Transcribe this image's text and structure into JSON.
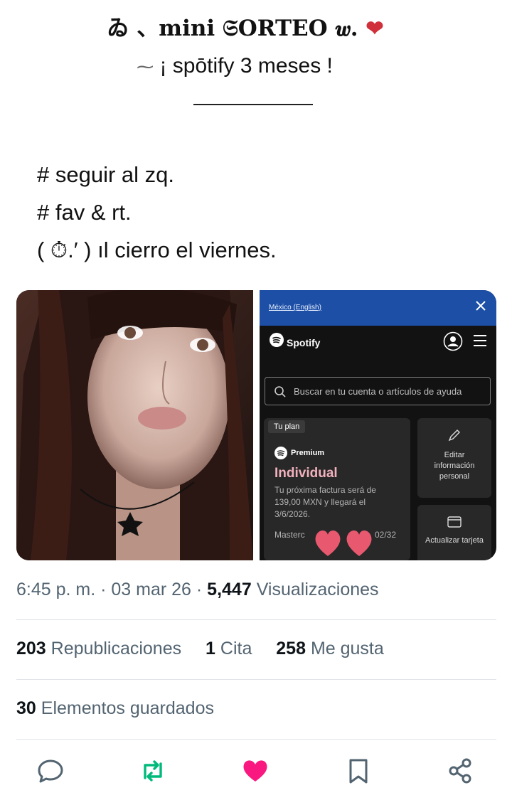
{
  "tweet": {
    "title": "ゐ 、mini 𝔖ORTEO  𝒘.",
    "title_emoji": "❤",
    "subtitle_deco": "⁓",
    "subtitle": "¡ spōtify 3 meses !",
    "lines": [
      "# seguir al zq.",
      "# fav & rt.",
      "( ⏱.′ ) ıl  cierro el viernes."
    ]
  },
  "media": {
    "screenshot": {
      "region_link": "México (English)",
      "brand": "Spotify",
      "search_placeholder": "Buscar en tu cuenta o artículos de ayuda",
      "plan_tag": "Tu plan",
      "premium": "Premium",
      "plan_name": "Individual",
      "bill_text": "Tu próxima factura será de 139,00 MXN y llegará el 3/6/2026.",
      "card_text": "Masterc",
      "card_exp": "02/32",
      "edit_label": "Editar información personal",
      "update_label": "Actualizar tarjeta"
    }
  },
  "meta": {
    "time": "6:45 p. m.",
    "date": "03 mar 26",
    "views_count": "5,447",
    "views_label": "Visualizaciones"
  },
  "stats": {
    "reposts_count": "203",
    "reposts_label": "Republicaciones",
    "quotes_count": "1",
    "quotes_label": "Cita",
    "likes_count": "258",
    "likes_label": "Me gusta",
    "saves_count": "30",
    "saves_label": "Elementos guardados"
  },
  "colors": {
    "accent_like": "#f91880",
    "accent_repost": "#00ba7c",
    "muted": "#536471"
  },
  "actions": [
    "reply-icon",
    "repost-icon",
    "like-icon",
    "bookmark-icon",
    "share-icon"
  ]
}
